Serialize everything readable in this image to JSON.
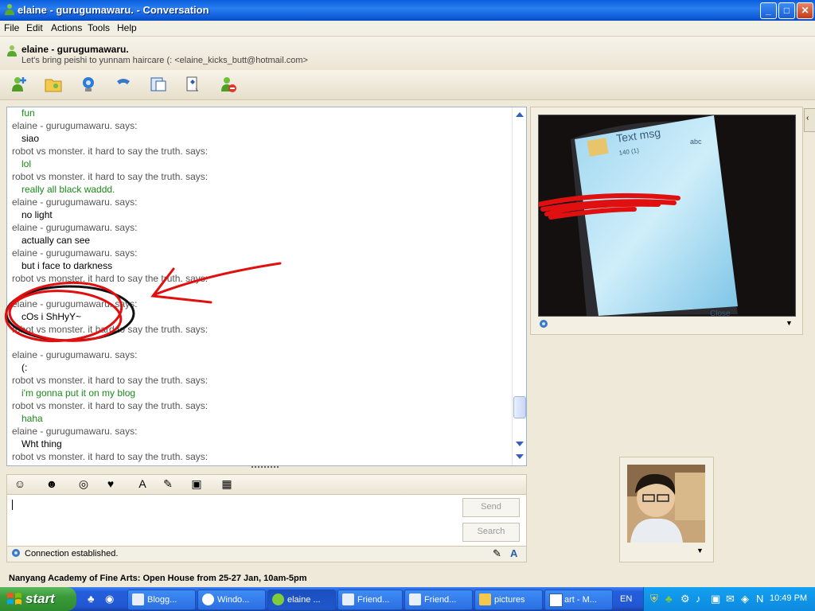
{
  "window": {
    "title": "elaine - gurugumawaru. - Conversation",
    "buttons": {
      "minimize": "_",
      "maximize": "□",
      "close": "✕"
    }
  },
  "menu": [
    "File",
    "Edit",
    "Actions",
    "Tools",
    "Help"
  ],
  "header": {
    "contact_name": "elaine - gurugumawaru.",
    "personal_message": "Let's bring peishi to yunnam haircare (: <elaine_kicks_butt@hotmail.com>"
  },
  "toolbar_icons": [
    "invite-contact-icon",
    "share-files-icon",
    "video-call-icon",
    "call-icon",
    "activities-icon",
    "games-icon",
    "block-icon"
  ],
  "chat": [
    {
      "kind": "them-msg",
      "text": "fun"
    },
    {
      "kind": "says",
      "text": "elaine - gurugumawaru. says:"
    },
    {
      "kind": "me-msg",
      "text": "siao"
    },
    {
      "kind": "says",
      "text": "robot vs monster. it hard to say the truth. says:"
    },
    {
      "kind": "them-msg",
      "text": "lol"
    },
    {
      "kind": "says",
      "text": "robot vs monster. it hard to say the truth. says:"
    },
    {
      "kind": "them-msg",
      "text": "really all black waddd."
    },
    {
      "kind": "says",
      "text": "elaine - gurugumawaru. says:"
    },
    {
      "kind": "me-msg",
      "text": "no light"
    },
    {
      "kind": "says",
      "text": "elaine - gurugumawaru. says:"
    },
    {
      "kind": "me-msg",
      "text": "actually can see"
    },
    {
      "kind": "says",
      "text": "elaine - gurugumawaru. says:"
    },
    {
      "kind": "me-msg",
      "text": "but i face to darkness"
    },
    {
      "kind": "says",
      "text": "robot vs monster. it hard to say the truth. says:"
    },
    {
      "kind": "them-msg",
      "text": ""
    },
    {
      "kind": "says",
      "text": "elaine - gurugumawaru. says:"
    },
    {
      "kind": "me-msg",
      "text": "cOs i ShHyY~"
    },
    {
      "kind": "says",
      "text": "robot vs monster. it hard to say the truth. says:"
    },
    {
      "kind": "them-msg",
      "text": ""
    },
    {
      "kind": "says",
      "text": "elaine - gurugumawaru. says:"
    },
    {
      "kind": "me-msg",
      "text": "(:"
    },
    {
      "kind": "says",
      "text": "robot vs monster. it hard to say the truth. says:"
    },
    {
      "kind": "them-msg",
      "text": "i'm gonna put it on my blog"
    },
    {
      "kind": "says",
      "text": "robot vs monster. it hard to say the truth. says:"
    },
    {
      "kind": "them-msg",
      "text": "haha"
    },
    {
      "kind": "says",
      "text": "elaine - gurugumawaru. says:"
    },
    {
      "kind": "me-msg",
      "text": "Wht thing"
    },
    {
      "kind": "says",
      "text": "robot vs monster. it hard to say the truth. says:"
    }
  ],
  "compose": {
    "send_label": "Send",
    "search_label": "Search",
    "status": "Connection established.",
    "toolbar_icons": [
      "emoticon-icon",
      "wink-icon",
      "nudge-icon",
      "voice-clip-icon",
      "font-icon",
      "background-icon",
      "picture-icon",
      "gift-icon"
    ]
  },
  "video": {
    "phone_screen_text": "Text msg",
    "phone_counter": "140 (1)",
    "phone_mode": "abc",
    "phone_softkey": "Close"
  },
  "ad_text": "Nanyang Academy of Fine Arts: Open House from 25-27 Jan, 10am-5pm",
  "taskbar": {
    "start_label": "start",
    "tasks": [
      {
        "label": "Blogg...",
        "active": false
      },
      {
        "label": "Windo...",
        "active": false
      },
      {
        "label": "elaine ...",
        "active": true
      },
      {
        "label": "Friend...",
        "active": false
      },
      {
        "label": "Friend...",
        "active": false
      },
      {
        "label": "pictures",
        "active": false
      },
      {
        "label": "art - M...",
        "active": false
      }
    ],
    "language": "EN",
    "clock": "10:49 PM"
  },
  "colors": {
    "accent_blue": "#0a56d3",
    "green_text": "#1a8a1a",
    "annotation_red": "#e01010"
  }
}
